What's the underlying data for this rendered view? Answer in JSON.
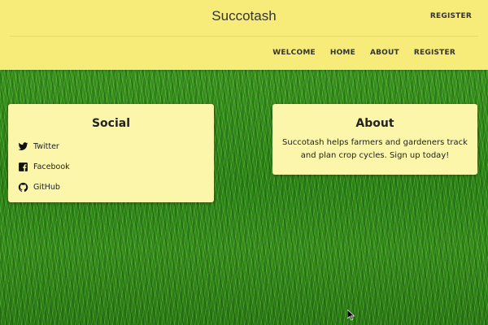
{
  "header": {
    "title": "Succotash",
    "register_label": "REGISTER",
    "nav": [
      "WELCOME",
      "HOME",
      "ABOUT",
      "REGISTER"
    ]
  },
  "social": {
    "title": "Social",
    "items": [
      {
        "label": "Twitter",
        "icon": "twitter-icon"
      },
      {
        "label": "Facebook",
        "icon": "facebook-icon"
      },
      {
        "label": "GitHub",
        "icon": "github-icon"
      }
    ]
  },
  "about": {
    "title": "About",
    "text": "Succotash helps farmers and gardeners track and plan crop cycles. Sign up today!"
  },
  "colors": {
    "header_bg": "#f7ec7a",
    "card_bg": "#fbf6a9",
    "grass": "#2f8a1e"
  }
}
